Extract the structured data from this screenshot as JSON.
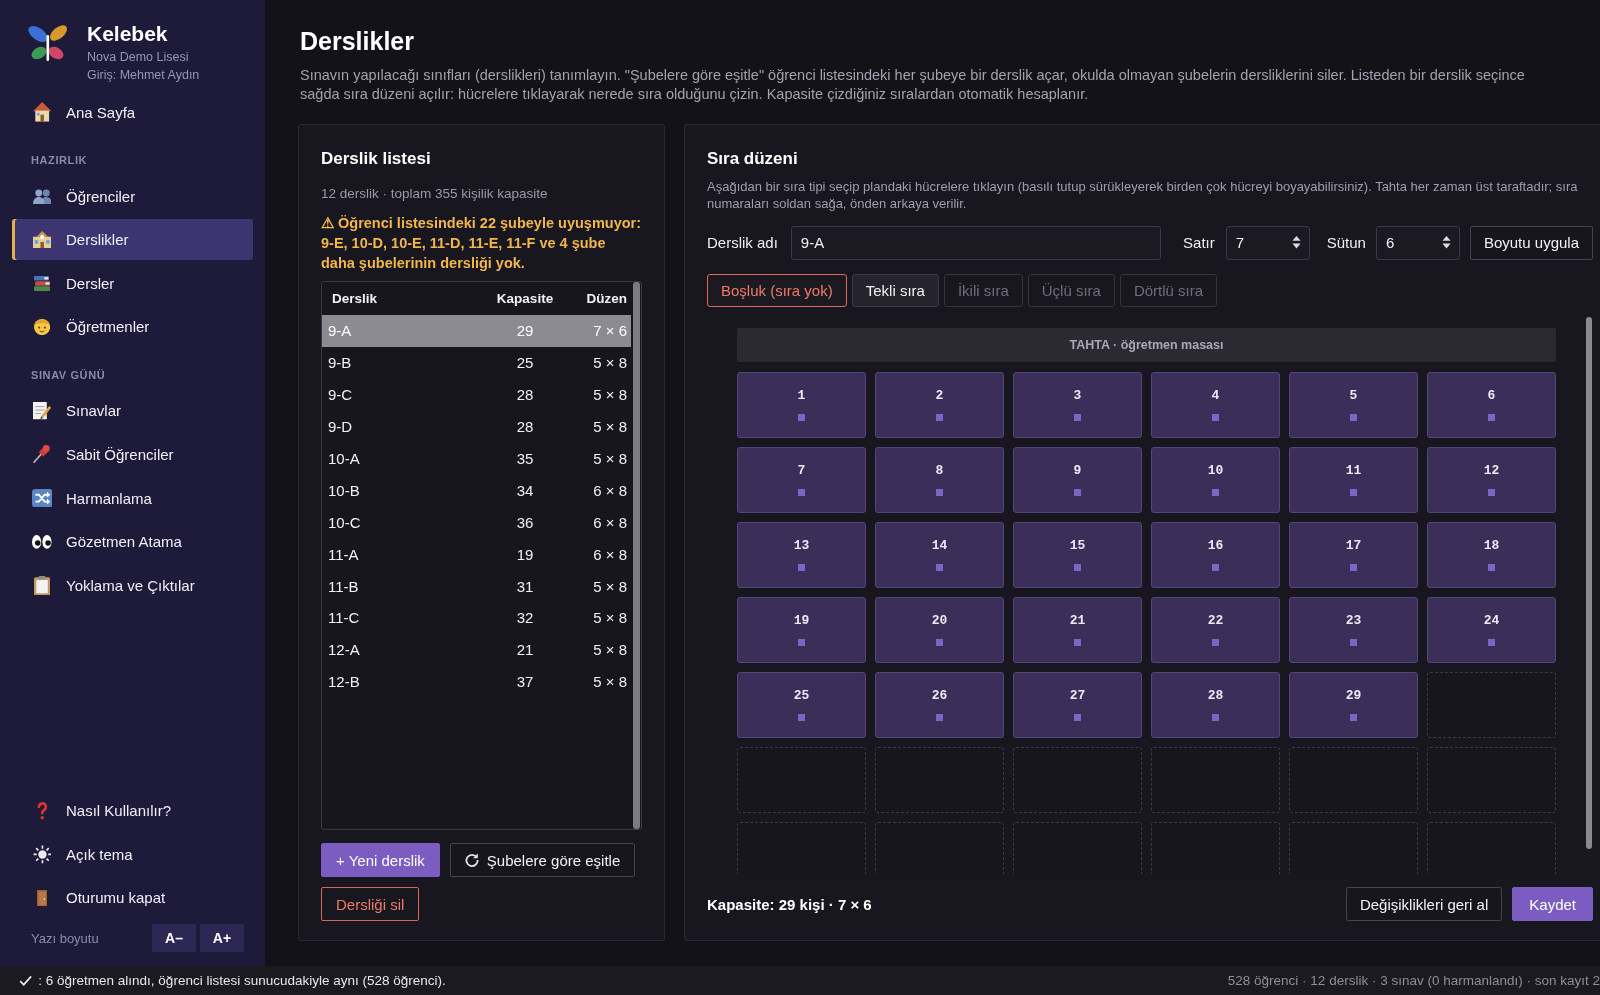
{
  "sidebar": {
    "brand": {
      "name": "Kelebek",
      "school": "Nova Demo Lisesi",
      "user": "Giriş: Mehmet Aydın"
    },
    "sections": [
      {
        "items": [
          {
            "label": "Ana Sayfa",
            "selected": false
          }
        ]
      },
      {
        "title": "HAZIRLIK",
        "items": [
          {
            "label": "Öğrenciler",
            "selected": false
          },
          {
            "label": "Derslikler",
            "selected": true
          },
          {
            "label": "Dersler",
            "selected": false
          },
          {
            "label": "Öğretmenler",
            "selected": false
          }
        ]
      },
      {
        "title": "SINAV GÜNÜ",
        "items": [
          {
            "label": "Sınavlar",
            "selected": false
          },
          {
            "label": "Sabit Öğrenciler",
            "selected": false
          },
          {
            "label": "Harmanlama",
            "selected": false
          },
          {
            "label": "Gözetmen Atama",
            "selected": false
          },
          {
            "label": "Yoklama ve Çıktılar",
            "selected": false
          }
        ]
      }
    ],
    "footer_items": [
      {
        "label": "Nasıl Kullanılır?"
      },
      {
        "label": "Açık tema"
      },
      {
        "label": "Oturumu kapat"
      }
    ],
    "font_size": {
      "label": "Yazı boyutu",
      "buttons": [
        "A–",
        "A+"
      ]
    }
  },
  "page": {
    "title": "Derslikler",
    "description": "Sınavın yapılacağı sınıfları (derslikleri) tanımlayın. \"Şubelere göre eşitle\" öğrenci listesindeki her şubeye bir derslik açar, okulda olmayan şubelerin dersliklerini siler. Listeden bir derslik seçince sağda sıra düzeni açılır: hücrelere tıklayarak nerede sıra olduğunu çizin. Kapasite çizdiğiniz sıralardan otomatik hesaplanır."
  },
  "room_list": {
    "title": "Derslik listesi",
    "summary": "12 derslik · toplam 355 kişilik kapasite",
    "warning": "⚠ Öğrenci listesindeki 22 şubeyle uyuşmuyor: 9-E, 10-D, 10-E, 11-D, 11-E, 11-F ve 4 şube daha şubelerinin dersliği yok.",
    "table": {
      "columns": [
        "Derslik",
        "Kapasite",
        "Düzen"
      ],
      "rows": [
        {
          "cells": [
            "9-A",
            "29",
            "7 × 6"
          ],
          "selected": true
        },
        {
          "cells": [
            "9-B",
            "25",
            "5 × 8"
          ],
          "selected": false
        },
        {
          "cells": [
            "9-C",
            "28",
            "5 × 8"
          ],
          "selected": false
        },
        {
          "cells": [
            "9-D",
            "28",
            "5 × 8"
          ],
          "selected": false
        },
        {
          "cells": [
            "10-A",
            "35",
            "5 × 8"
          ],
          "selected": false
        },
        {
          "cells": [
            "10-B",
            "34",
            "6 × 8"
          ],
          "selected": false
        },
        {
          "cells": [
            "10-C",
            "36",
            "6 × 8"
          ],
          "selected": false
        },
        {
          "cells": [
            "11-A",
            "19",
            "6 × 8"
          ],
          "selected": false
        },
        {
          "cells": [
            "11-B",
            "31",
            "5 × 8"
          ],
          "selected": false
        },
        {
          "cells": [
            "11-C",
            "32",
            "5 × 8"
          ],
          "selected": false
        },
        {
          "cells": [
            "12-A",
            "21",
            "5 × 8"
          ],
          "selected": false
        },
        {
          "cells": [
            "12-B",
            "37",
            "5 × 8"
          ],
          "selected": false
        }
      ]
    },
    "buttons": [
      {
        "label": "+ Yeni derslik",
        "kind": "primary"
      },
      {
        "label": "Şubelere göre eşitle",
        "kind": "refresh"
      },
      {
        "label": "Dersliği sil",
        "kind": "danger"
      }
    ]
  },
  "seat_plan": {
    "title": "Sıra düzeni",
    "description": "Aşağıdan bir sıra tipi seçip plandaki hücrelere tıklayın (basılı tutup sürükleyerek birden çok hücreyi boyayabilirsiniz). Tahta her zaman üst taraftadır; sıra numaraları soldan sağa, önden arkaya verilir.",
    "name_field": {
      "label": "Derslik adı",
      "value": "9-A"
    },
    "size_fields": [
      {
        "label": "Satır",
        "value": "7"
      },
      {
        "label": "Sütun",
        "value": "6"
      }
    ],
    "apply_button": "Boyutu uygula",
    "tools": [
      {
        "label": "Boşluk (sıra yok)",
        "selected": true,
        "disabled": false
      },
      {
        "label": "Tekli sıra",
        "selected": false,
        "disabled": false
      },
      {
        "label": "İkili sıra",
        "selected": false,
        "disabled": true
      },
      {
        "label": "Üçlü sıra",
        "selected": false,
        "disabled": true
      },
      {
        "label": "Dörtlü sıra",
        "selected": false,
        "disabled": true
      }
    ],
    "board": "TAHTA · öğretmen masası",
    "grid": [
      [
        {
          "kind": "single",
          "label": "1"
        },
        {
          "kind": "single",
          "label": "2"
        },
        {
          "kind": "single",
          "label": "3"
        },
        {
          "kind": "single",
          "label": "4"
        },
        {
          "kind": "single",
          "label": "5"
        },
        {
          "kind": "single",
          "label": "6"
        }
      ],
      [
        {
          "kind": "single",
          "label": "7"
        },
        {
          "kind": "single",
          "label": "8"
        },
        {
          "kind": "single",
          "label": "9"
        },
        {
          "kind": "single",
          "label": "10"
        },
        {
          "kind": "single",
          "label": "11"
        },
        {
          "kind": "single",
          "label": "12"
        }
      ],
      [
        {
          "kind": "single",
          "label": "13"
        },
        {
          "kind": "single",
          "label": "14"
        },
        {
          "kind": "single",
          "label": "15"
        },
        {
          "kind": "single",
          "label": "16"
        },
        {
          "kind": "single",
          "label": "17"
        },
        {
          "kind": "single",
          "label": "18"
        }
      ],
      [
        {
          "kind": "single",
          "label": "19"
        },
        {
          "kind": "single",
          "label": "20"
        },
        {
          "kind": "single",
          "label": "21"
        },
        {
          "kind": "single",
          "label": "22"
        },
        {
          "kind": "single",
          "label": "23"
        },
        {
          "kind": "single",
          "label": "24"
        }
      ],
      [
        {
          "kind": "single",
          "label": "25"
        },
        {
          "kind": "single",
          "label": "26"
        },
        {
          "kind": "single",
          "label": "27"
        },
        {
          "kind": "single",
          "label": "28"
        },
        {
          "kind": "single",
          "label": "29"
        },
        {
          "kind": "empty"
        }
      ],
      [
        {
          "kind": "empty"
        },
        {
          "kind": "empty"
        },
        {
          "kind": "empty"
        },
        {
          "kind": "empty"
        },
        {
          "kind": "empty"
        },
        {
          "kind": "empty"
        }
      ],
      [
        {
          "kind": "empty"
        },
        {
          "kind": "empty"
        },
        {
          "kind": "empty"
        },
        {
          "kind": "empty"
        },
        {
          "kind": "empty"
        },
        {
          "kind": "empty"
        }
      ]
    ],
    "capacity": "Kapasite: 29 kişi · 7 × 6",
    "buttons": [
      {
        "label": "Değişiklikleri geri al",
        "kind": "secondary"
      },
      {
        "label": "Kaydet",
        "kind": "primary"
      }
    ]
  },
  "status_bar": {
    "message": ": 6 öğretmen alındı, öğrenci listesi sunucudakiyle aynı (528 öğrenci).",
    "stats": "528 öğrenci · 12 derslik · 3 sınav (0 harmanlandı) · son kayıt 2"
  }
}
